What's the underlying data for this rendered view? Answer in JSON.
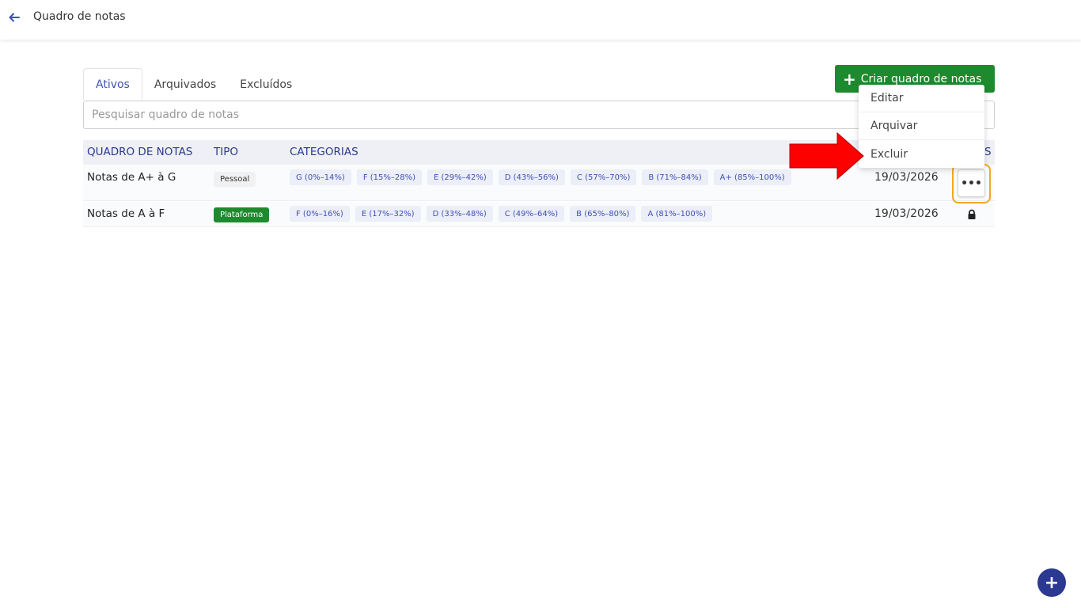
{
  "header": {
    "title": "Quadro de notas"
  },
  "tabs": [
    {
      "label": "Ativos"
    },
    {
      "label": "Arquivados"
    },
    {
      "label": "Excluídos"
    }
  ],
  "create_button": {
    "label": "Criar quadro de notas"
  },
  "search": {
    "placeholder": "Pesquisar quadro de notas"
  },
  "table": {
    "columns": [
      "QUADRO DE NOTAS",
      "TIPO",
      "CATEGORIAS",
      "S"
    ],
    "rows": [
      {
        "name": "Notas de A+ à G",
        "type": "Pessoal",
        "categories": [
          "G (0%–14%)",
          "F (15%–28%)",
          "E (29%–42%)",
          "D (43%–56%)",
          "C (57%–70%)",
          "B (71%–84%)",
          "A+ (85%–100%)"
        ],
        "date": "19/03/2026"
      },
      {
        "name": "Notas de A à F",
        "type": "Plataforma",
        "categories": [
          "F (0%–16%)",
          "E (17%–32%)",
          "D (33%–48%)",
          "C (49%–64%)",
          "B (65%–80%)",
          "A (81%–100%)"
        ],
        "date": "19/03/2026"
      }
    ]
  },
  "row_menu": {
    "items": [
      {
        "label": "Editar"
      },
      {
        "label": "Arquivar"
      },
      {
        "label": "Excluir"
      }
    ]
  },
  "more_button": {
    "label": "•••"
  },
  "fab": {
    "label": "+"
  },
  "colors": {
    "accent": "#3f51b5",
    "success": "#1e8a2e",
    "highlight": "#f5a623",
    "arrow": "#ff0000"
  }
}
